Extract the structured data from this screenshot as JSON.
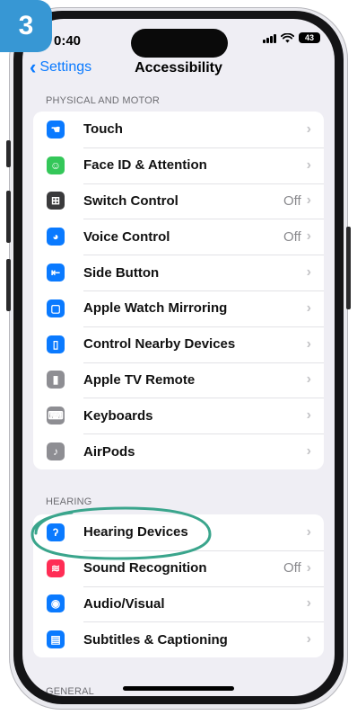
{
  "step_badge": "3",
  "status_bar": {
    "time": "0:40",
    "battery": "43"
  },
  "nav": {
    "back_label": "Settings",
    "title": "Accessibility"
  },
  "sections": [
    {
      "header": "PHYSICAL AND MOTOR",
      "items": [
        {
          "label": "Touch",
          "value": "",
          "icon": "touch-icon",
          "color": "#0a7aff"
        },
        {
          "label": "Face ID & Attention",
          "value": "",
          "icon": "face-id-icon",
          "color": "#34c759"
        },
        {
          "label": "Switch Control",
          "value": "Off",
          "icon": "switch-control-icon",
          "color": "#3a3a3c"
        },
        {
          "label": "Voice Control",
          "value": "Off",
          "icon": "voice-control-icon",
          "color": "#0a7aff"
        },
        {
          "label": "Side Button",
          "value": "",
          "icon": "side-button-icon",
          "color": "#0a7aff"
        },
        {
          "label": "Apple Watch Mirroring",
          "value": "",
          "icon": "apple-watch-mirroring-icon",
          "color": "#0a7aff"
        },
        {
          "label": "Control Nearby Devices",
          "value": "",
          "icon": "control-nearby-devices-icon",
          "color": "#0a7aff"
        },
        {
          "label": "Apple TV Remote",
          "value": "",
          "icon": "apple-tv-remote-icon",
          "color": "#8e8e93"
        },
        {
          "label": "Keyboards",
          "value": "",
          "icon": "keyboard-icon",
          "color": "#8e8e93"
        },
        {
          "label": "AirPods",
          "value": "",
          "icon": "airpods-icon",
          "color": "#8e8e93"
        }
      ]
    },
    {
      "header": "HEARING",
      "items": [
        {
          "label": "Hearing Devices",
          "value": "",
          "icon": "ear-icon",
          "color": "#0a7aff"
        },
        {
          "label": "Sound Recognition",
          "value": "Off",
          "icon": "sound-recognition-icon",
          "color": "#ff2d55"
        },
        {
          "label": "Audio/Visual",
          "value": "",
          "icon": "audio-visual-icon",
          "color": "#0a7aff"
        },
        {
          "label": "Subtitles & Captioning",
          "value": "",
          "icon": "subtitles-icon",
          "color": "#0a7aff"
        }
      ]
    },
    {
      "header": "GENERAL",
      "items": []
    }
  ],
  "colors": {
    "accent": "#0a7aff",
    "badge": "#3797d4",
    "highlight_ring": "#3aa58c"
  }
}
